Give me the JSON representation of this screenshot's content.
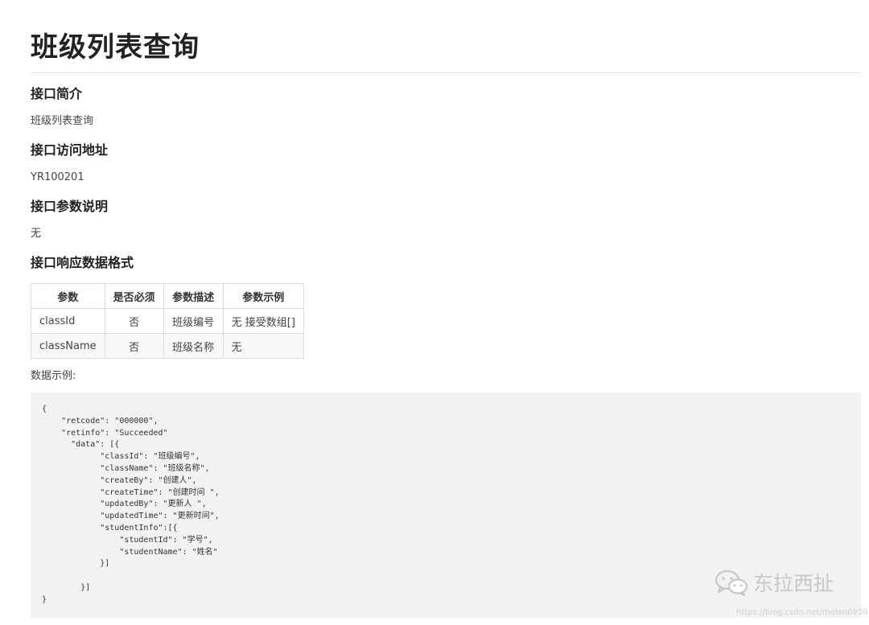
{
  "title": "班级列表查询",
  "sections": [
    {
      "heading": "接口简介",
      "text": "班级列表查询"
    },
    {
      "heading": "接口访问地址",
      "text": "YR100201"
    },
    {
      "heading": "接口参数说明",
      "text": "无"
    },
    {
      "heading": "接口响应数据格式"
    }
  ],
  "table": {
    "headers": [
      "参数",
      "是否必须",
      "参数描述",
      "参数示例"
    ],
    "rows": [
      [
        "classId",
        "否",
        "班级编号",
        "无 接受数组[]"
      ],
      [
        "className",
        "否",
        "班级名称",
        "无"
      ]
    ]
  },
  "example_label": "数据示例:",
  "code": "{\n    \"retcode\": \"000000\",\n    \"retinfo\": \"Succeeded\"\n      \"data\": [{\n            \"classId\": \"班级编号\",\n            \"className\": \"班级名称\",\n            \"createBy\": \"创建人\",\n            \"createTime\": \"创建时间 \",\n            \"updatedBy\": \"更新人 \",\n            \"updatedTime\": \"更新时间\",\n            \"studentInfo\":[{\n                \"studentId\": \"学号\",\n                \"studentName\": \"姓名\"\n            }]\n\n        }]\n}",
  "watermark": {
    "text": "东拉西扯",
    "url": "https://blog.csdn.net/molan6930"
  }
}
